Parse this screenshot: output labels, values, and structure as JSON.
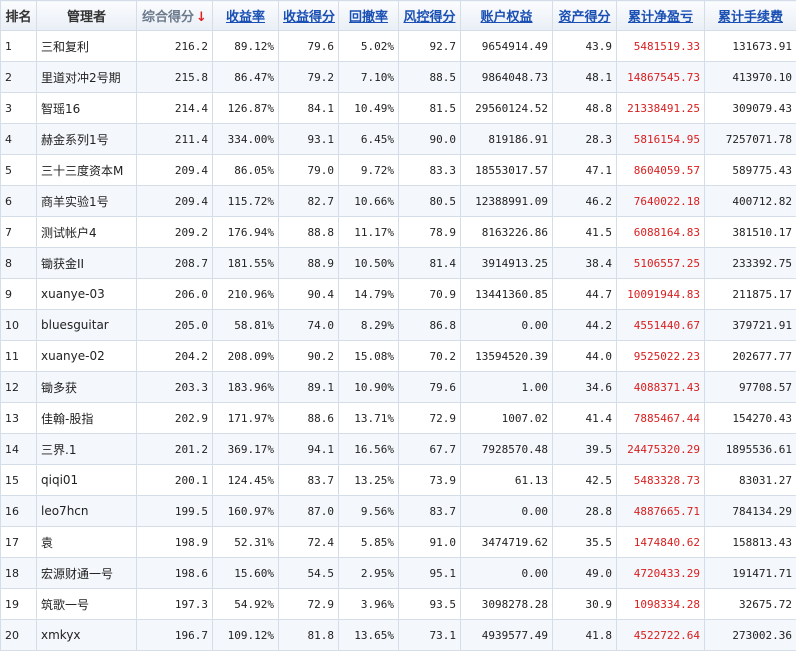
{
  "headers": {
    "rank": "排名",
    "manager": "管理者",
    "total_score": "综合得分",
    "sort_arrow": "↓",
    "return_rate": "收益率",
    "return_score": "收益得分",
    "drawdown": "回撤率",
    "risk_score": "风控得分",
    "equity": "账户权益",
    "asset_score": "资产得分",
    "cum_pnl": "累计净盈亏",
    "cum_fee": "累计手续费"
  },
  "rows": [
    {
      "rank": "1",
      "name": "三和复利",
      "score": "216.2",
      "ret": "89.12%",
      "ret_score": "79.6",
      "dd": "5.02%",
      "risk": "92.7",
      "equity": "9654914.49",
      "asset": "43.9",
      "pnl": "5481519.33",
      "fee": "131673.91"
    },
    {
      "rank": "2",
      "name": "里道对冲2号期",
      "score": "215.8",
      "ret": "86.47%",
      "ret_score": "79.2",
      "dd": "7.10%",
      "risk": "88.5",
      "equity": "9864048.73",
      "asset": "48.1",
      "pnl": "14867545.73",
      "fee": "413970.10"
    },
    {
      "rank": "3",
      "name": "智瑶16",
      "score": "214.4",
      "ret": "126.87%",
      "ret_score": "84.1",
      "dd": "10.49%",
      "risk": "81.5",
      "equity": "29560124.52",
      "asset": "48.8",
      "pnl": "21338491.25",
      "fee": "309079.43"
    },
    {
      "rank": "4",
      "name": "赫金系列1号",
      "score": "211.4",
      "ret": "334.00%",
      "ret_score": "93.1",
      "dd": "6.45%",
      "risk": "90.0",
      "equity": "819186.91",
      "asset": "28.3",
      "pnl": "5816154.95",
      "fee": "7257071.78"
    },
    {
      "rank": "5",
      "name": "三十三度资本M",
      "score": "209.4",
      "ret": "86.05%",
      "ret_score": "79.0",
      "dd": "9.72%",
      "risk": "83.3",
      "equity": "18553017.57",
      "asset": "47.1",
      "pnl": "8604059.57",
      "fee": "589775.43"
    },
    {
      "rank": "6",
      "name": "商羊实验1号",
      "score": "209.4",
      "ret": "115.72%",
      "ret_score": "82.7",
      "dd": "10.66%",
      "risk": "80.5",
      "equity": "12388991.09",
      "asset": "46.2",
      "pnl": "7640022.18",
      "fee": "400712.82"
    },
    {
      "rank": "7",
      "name": "测试帐户4",
      "score": "209.2",
      "ret": "176.94%",
      "ret_score": "88.8",
      "dd": "11.17%",
      "risk": "78.9",
      "equity": "8163226.86",
      "asset": "41.5",
      "pnl": "6088164.83",
      "fee": "381510.17"
    },
    {
      "rank": "8",
      "name": "锄获金II",
      "score": "208.7",
      "ret": "181.55%",
      "ret_score": "88.9",
      "dd": "10.50%",
      "risk": "81.4",
      "equity": "3914913.25",
      "asset": "38.4",
      "pnl": "5106557.25",
      "fee": "233392.75"
    },
    {
      "rank": "9",
      "name": "xuanye-03",
      "score": "206.0",
      "ret": "210.96%",
      "ret_score": "90.4",
      "dd": "14.79%",
      "risk": "70.9",
      "equity": "13441360.85",
      "asset": "44.7",
      "pnl": "10091944.83",
      "fee": "211875.17"
    },
    {
      "rank": "10",
      "name": "bluesguitar",
      "score": "205.0",
      "ret": "58.81%",
      "ret_score": "74.0",
      "dd": "8.29%",
      "risk": "86.8",
      "equity": "0.00",
      "asset": "44.2",
      "pnl": "4551440.67",
      "fee": "379721.91"
    },
    {
      "rank": "11",
      "name": "xuanye-02",
      "score": "204.2",
      "ret": "208.09%",
      "ret_score": "90.2",
      "dd": "15.08%",
      "risk": "70.2",
      "equity": "13594520.39",
      "asset": "44.0",
      "pnl": "9525022.23",
      "fee": "202677.77"
    },
    {
      "rank": "12",
      "name": "锄多获",
      "score": "203.3",
      "ret": "183.96%",
      "ret_score": "89.1",
      "dd": "10.90%",
      "risk": "79.6",
      "equity": "1.00",
      "asset": "34.6",
      "pnl": "4088371.43",
      "fee": "97708.57"
    },
    {
      "rank": "13",
      "name": "佳翰-股指",
      "score": "202.9",
      "ret": "171.97%",
      "ret_score": "88.6",
      "dd": "13.71%",
      "risk": "72.9",
      "equity": "1007.02",
      "asset": "41.4",
      "pnl": "7885467.44",
      "fee": "154270.43"
    },
    {
      "rank": "14",
      "name": "三界.1",
      "score": "201.2",
      "ret": "369.17%",
      "ret_score": "94.1",
      "dd": "16.56%",
      "risk": "67.7",
      "equity": "7928570.48",
      "asset": "39.5",
      "pnl": "24475320.29",
      "fee": "1895536.61"
    },
    {
      "rank": "15",
      "name": "qiqi01",
      "score": "200.1",
      "ret": "124.45%",
      "ret_score": "83.7",
      "dd": "13.25%",
      "risk": "73.9",
      "equity": "61.13",
      "asset": "42.5",
      "pnl": "5483328.73",
      "fee": "83031.27"
    },
    {
      "rank": "16",
      "name": "leo7hcn",
      "score": "199.5",
      "ret": "160.97%",
      "ret_score": "87.0",
      "dd": "9.56%",
      "risk": "83.7",
      "equity": "0.00",
      "asset": "28.8",
      "pnl": "4887665.71",
      "fee": "784134.29"
    },
    {
      "rank": "17",
      "name": "袁",
      "score": "198.9",
      "ret": "52.31%",
      "ret_score": "72.4",
      "dd": "5.85%",
      "risk": "91.0",
      "equity": "3474719.62",
      "asset": "35.5",
      "pnl": "1474840.62",
      "fee": "158813.43"
    },
    {
      "rank": "18",
      "name": "宏源财通一号",
      "score": "198.6",
      "ret": "15.60%",
      "ret_score": "54.5",
      "dd": "2.95%",
      "risk": "95.1",
      "equity": "0.00",
      "asset": "49.0",
      "pnl": "4720433.29",
      "fee": "191471.71"
    },
    {
      "rank": "19",
      "name": "筑歌一号",
      "score": "197.3",
      "ret": "54.92%",
      "ret_score": "72.9",
      "dd": "3.96%",
      "risk": "93.5",
      "equity": "3098278.28",
      "asset": "30.9",
      "pnl": "1098334.28",
      "fee": "32675.72"
    },
    {
      "rank": "20",
      "name": "xmkyx",
      "score": "196.7",
      "ret": "109.12%",
      "ret_score": "81.8",
      "dd": "13.65%",
      "risk": "73.1",
      "equity": "4939577.49",
      "asset": "41.8",
      "pnl": "4522722.64",
      "fee": "273002.36"
    }
  ]
}
